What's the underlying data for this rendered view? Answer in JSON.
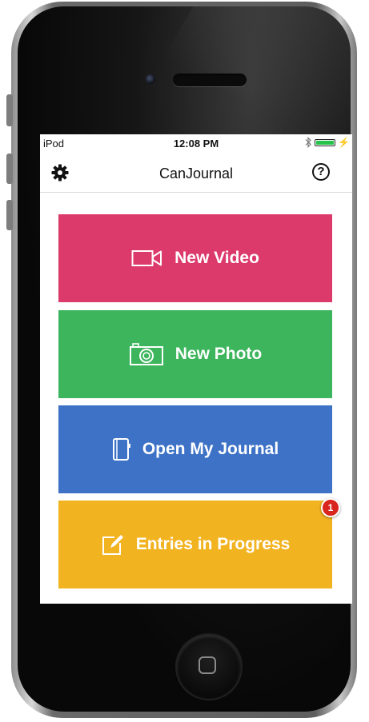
{
  "status_bar": {
    "carrier": "iPod",
    "time": "12:08 PM",
    "bluetooth_icon": "bluetooth-icon",
    "battery_icon": "battery-icon",
    "charging_icon": "charging-icon"
  },
  "nav": {
    "title": "CanJournal",
    "settings_icon": "gear-icon",
    "help_icon": "help-icon",
    "help_glyph": "?"
  },
  "tiles": [
    {
      "label": "New Video",
      "icon": "video-camera-icon",
      "color": "#dd3a6c"
    },
    {
      "label": "New Photo",
      "icon": "camera-icon",
      "color": "#3db55c"
    },
    {
      "label": "Open My Journal",
      "icon": "journal-icon",
      "color": "#3d72c6"
    },
    {
      "label": "Entries in Progress",
      "icon": "edit-icon",
      "color": "#f2b321"
    }
  ],
  "progress_badge": {
    "count": "1",
    "color": "#d9261c"
  }
}
